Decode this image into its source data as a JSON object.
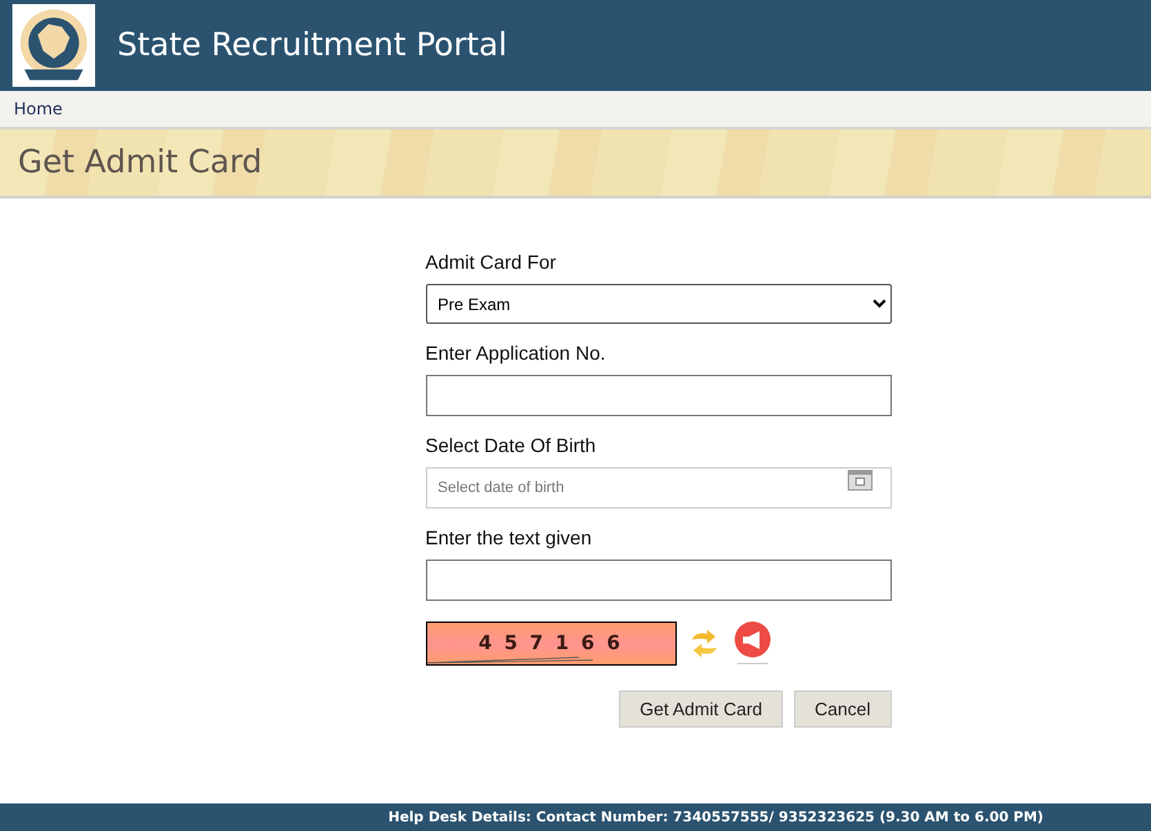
{
  "header": {
    "title": "State Recruitment Portal"
  },
  "nav": {
    "items": [
      {
        "label": "Home"
      }
    ]
  },
  "banner": {
    "title": "Get Admit Card"
  },
  "form": {
    "fields": [
      {
        "kind": "select",
        "label": "Admit Card For",
        "value": "Pre Exam"
      },
      {
        "kind": "text",
        "label": "Enter Application No."
      },
      {
        "kind": "date",
        "label": "Select Date Of Birth",
        "placeholder": "Select date of birth"
      },
      {
        "kind": "text",
        "label": "Enter the text given"
      }
    ],
    "captcha": {
      "text": "4 5 7 1 6 6"
    },
    "buttons": [
      {
        "label": "Get Admit Card"
      },
      {
        "label": "Cancel"
      }
    ]
  },
  "footer": {
    "text": "Help Desk Details: Contact Number: 7340557555/ 9352323625 (9.30 AM to 6.00 PM)"
  }
}
